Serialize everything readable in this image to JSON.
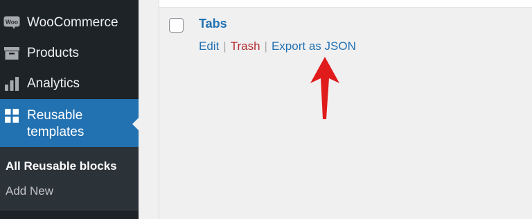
{
  "sidebar": {
    "items": [
      {
        "label": "WooCommerce",
        "icon": "woocommerce-icon"
      },
      {
        "label": "Products",
        "icon": "archive-box-icon"
      },
      {
        "label": "Analytics",
        "icon": "bar-chart-icon"
      },
      {
        "label": "Reusable templates",
        "icon": "grid-blocks-icon"
      }
    ],
    "submenu": [
      {
        "label": "All Reusable blocks"
      },
      {
        "label": "Add New"
      }
    ],
    "icon_woo_text": "Woo"
  },
  "content": {
    "row": {
      "title": "Tabs",
      "actions": {
        "edit": "Edit",
        "trash": "Trash",
        "export": "Export as JSON",
        "separator": "|"
      }
    },
    "annotation": {
      "type": "arrow-up",
      "color": "#e01b1b"
    }
  },
  "colors": {
    "sidebar_bg": "#1d2327",
    "submenu_bg": "#2c3338",
    "active_bg": "#2271b1",
    "link": "#2271b1",
    "trash": "#b32d2e",
    "content_bg": "#f0f0f1"
  }
}
